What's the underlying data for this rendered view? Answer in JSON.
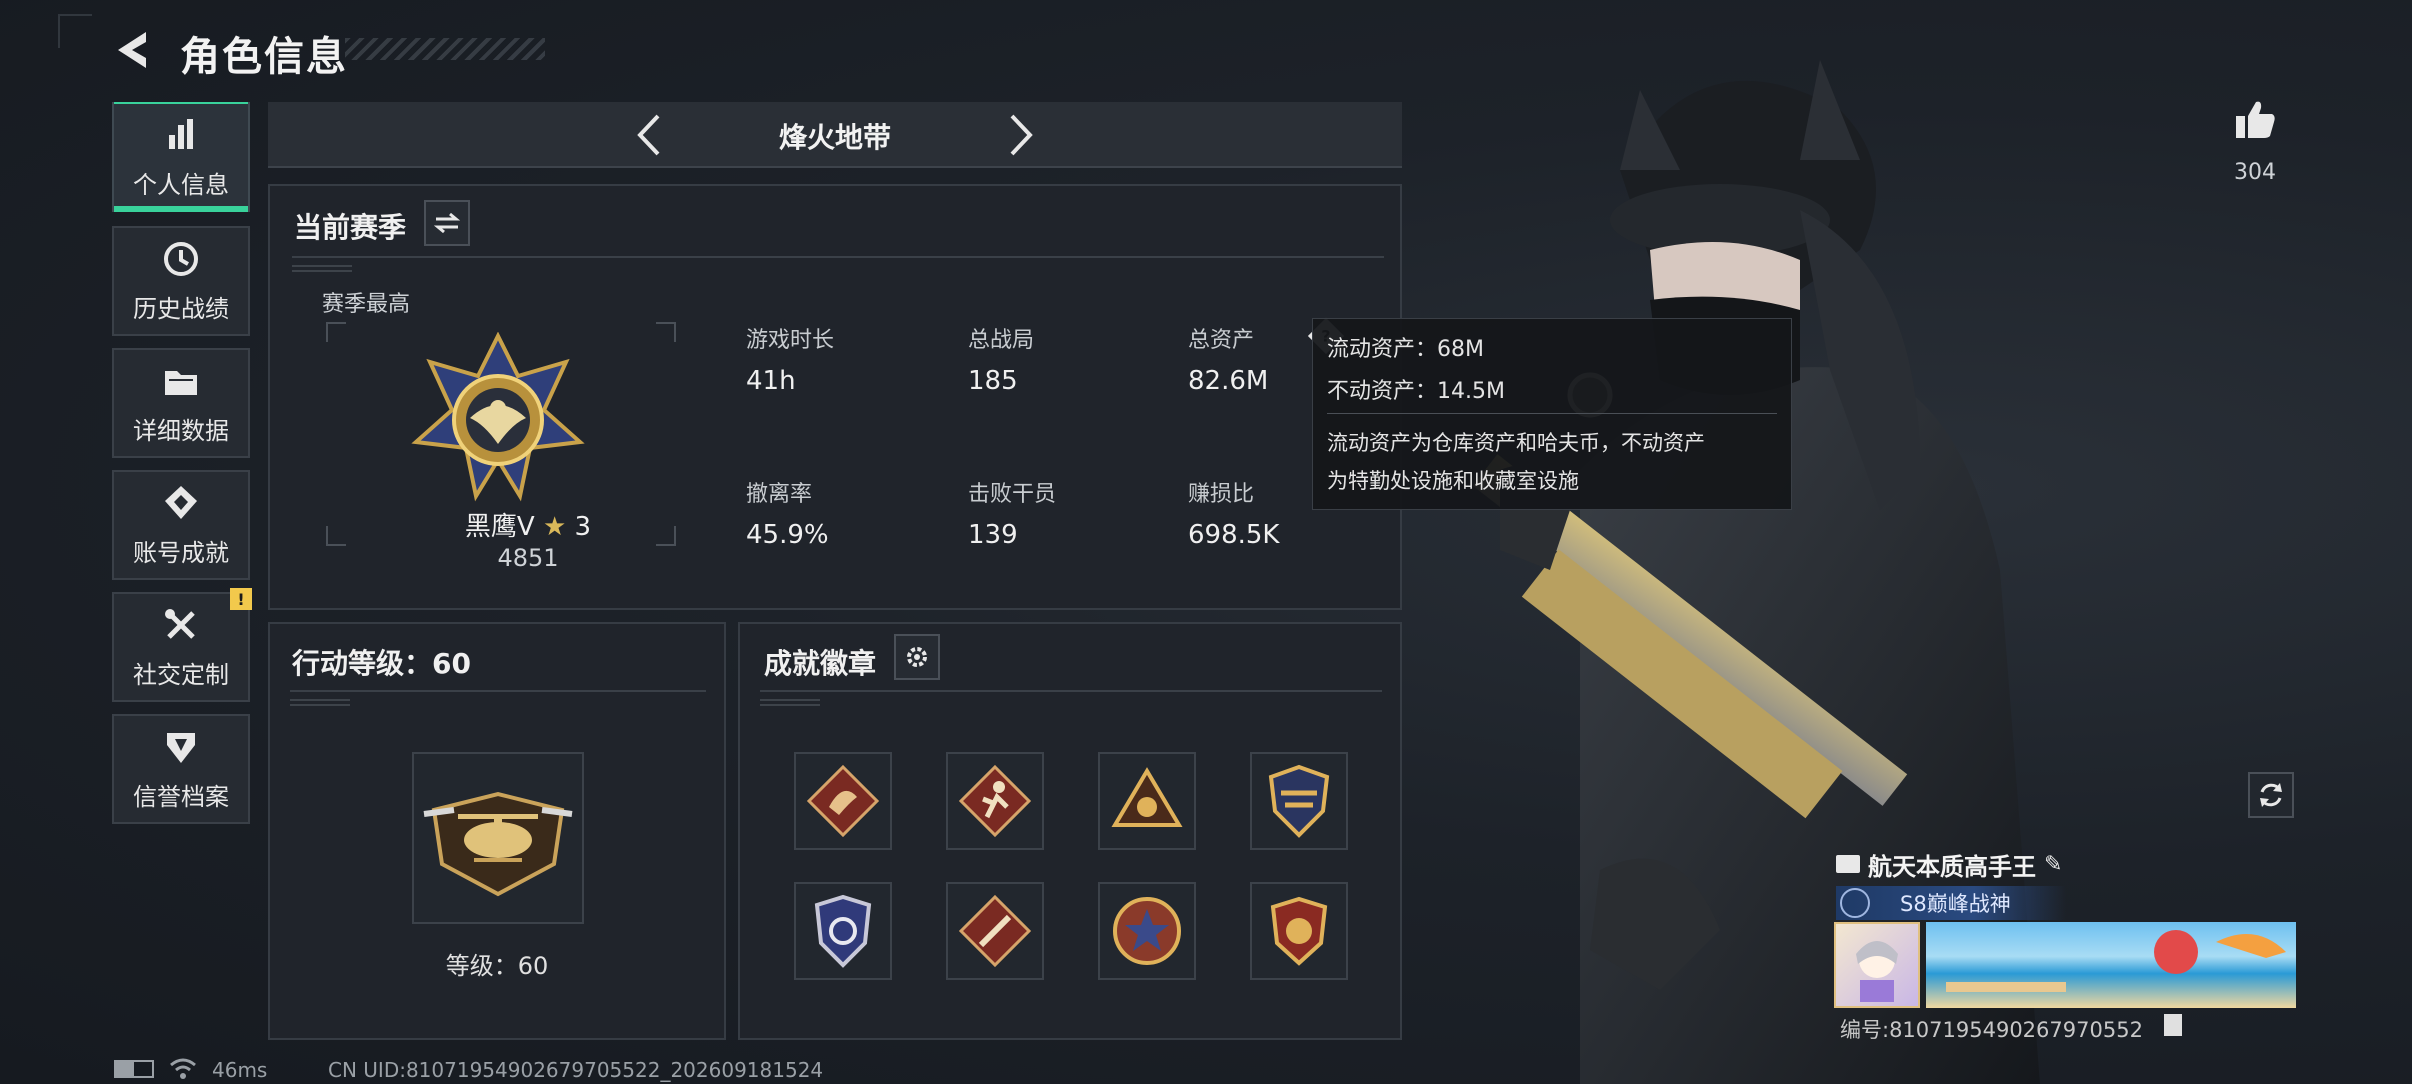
{
  "header": {
    "title": "角色信息"
  },
  "sidebar": {
    "items": [
      {
        "label": "个人信息",
        "icon": "bar-chart-icon",
        "active": true
      },
      {
        "label": "历史战绩",
        "icon": "clock-icon"
      },
      {
        "label": "详细数据",
        "icon": "folder-icon"
      },
      {
        "label": "账号成就",
        "icon": "achievement-icon"
      },
      {
        "label": "社交定制",
        "icon": "wrench-icon",
        "badge": "!"
      },
      {
        "label": "信誉档案",
        "icon": "shield-icon"
      }
    ]
  },
  "mode": {
    "title": "烽火地带"
  },
  "season": {
    "title": "当前赛季",
    "best_label": "赛季最高",
    "rank_name": "黑鹰V",
    "rank_stars": "3",
    "rank_score": "4851",
    "stats": [
      {
        "label": "游戏时长",
        "value": "41h"
      },
      {
        "label": "总战局",
        "value": "185"
      },
      {
        "label": "总资产",
        "value": "82.6M"
      },
      {
        "label": "撤离率",
        "value": "45.9%"
      },
      {
        "label": "击败干员",
        "value": "139"
      },
      {
        "label": "赚损比",
        "value": "698.5K"
      }
    ]
  },
  "tooltip": {
    "liquid": "流动资产：68M",
    "fixed": "不动资产：14.5M",
    "desc_line1": "流动资产为仓库资产和哈夫币，不动资产",
    "desc_line2": "为特勤处设施和收藏室设施"
  },
  "action_level": {
    "title": "行动等级：60",
    "level_text": "等级：60"
  },
  "achievements": {
    "title": "成就徽章",
    "badges": [
      "dragon-badge",
      "runner-badge",
      "triangle-badge",
      "shield-gold-badge",
      "blue-shield-badge",
      "knife-badge",
      "star-medal-badge",
      "gold-crest-badge"
    ]
  },
  "profile_card": {
    "name": "航天本质高手王",
    "title_badge": "S8巅峰战神",
    "id_text": "编号:8107195490267970552"
  },
  "likes": {
    "count": "304"
  },
  "status": {
    "ping": "46ms",
    "uid": "CN UID:81071954902679705522_202609181524"
  },
  "colors": {
    "accent": "#39d29b",
    "badge_yellow": "#f2c94c",
    "title_blue": "#1f3a66"
  }
}
